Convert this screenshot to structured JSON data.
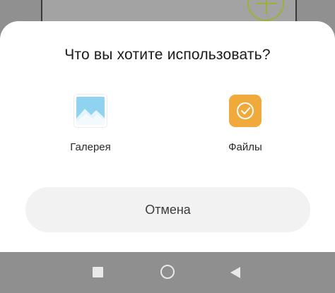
{
  "dialog": {
    "title": "Что вы хотите использовать?",
    "options": [
      {
        "label": "Галерея",
        "icon": "gallery-icon"
      },
      {
        "label": "Файлы",
        "icon": "files-icon"
      }
    ],
    "cancel_label": "Отмена"
  },
  "navbar": {
    "buttons": [
      "recent-apps-icon",
      "home-icon",
      "back-icon"
    ]
  },
  "colors": {
    "files_accent": "#f0a93b",
    "gallery_sky": "#8fd3f0",
    "fab_accent": "#9bb23a",
    "overlay": "#8f8f8f"
  }
}
